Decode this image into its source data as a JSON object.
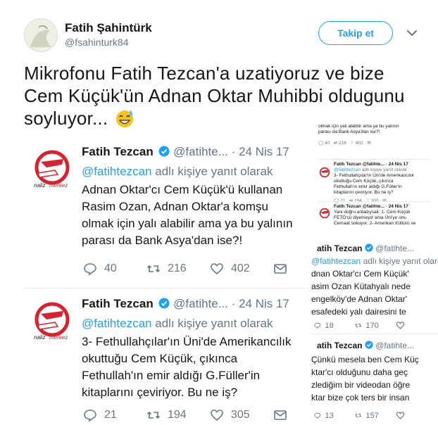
{
  "author": {
    "name": "Fatih Şahintürk",
    "handle": "@fsahinturk84",
    "follow_label": "Takip et"
  },
  "tweet": {
    "text": "Mikrofonu Fatih Tezcan'a uzatiyoruz ve bize Cem Küçük'ün Adnan Oktar Muhibbi oldugunu soyluyor...",
    "emoji": "sweat-smile-emoji"
  },
  "quoted_tweets": [
    {
      "name": "Fatih Tezcan",
      "handle": "@fatihte...",
      "sep": "·",
      "date": "24 Nis 17",
      "reply_link": "@fatihtezcan",
      "reply_text": "adlı kişiye yanıt olarak",
      "lines": [
        "Adnan Oktar'cı Cem Küçük'ü kullanan",
        "Rasim Ozan, Adnan Oktar'a komşu",
        "olmak için yalı alabilir ama ya bu yalının",
        "parası da Bank Asya'dan ise?!"
      ],
      "replies": "40",
      "retweets": "216",
      "likes": "402"
    },
    {
      "name": "Fatih Tezcan",
      "handle": "@fatihte...",
      "sep": "·",
      "date": "24 Nis 17",
      "reply_link": "@fatihtezcan",
      "reply_text": "adlı kişiye yanıt olarak",
      "lines": [
        "3- Fethullahçılar'ın Üni'de Amerikancılık",
        "okuttuğu Cem Küçük, çıkınca",
        "Fethullah'ın emir aldığı G.Füller'in",
        "kitaplarını çeviriyor. Bu ne iş?"
      ],
      "replies": "21",
      "retweets": "194",
      "likes": "305"
    }
  ],
  "right_column": {
    "small1": {
      "lines": [
        "olmak için yalı alabilir ama ya bu yalının",
        "parası da Bank Asya'dan ise?!"
      ],
      "replies": "40",
      "retweets": "216",
      "likes": "402"
    },
    "small2": {
      "header": "Fatih Tezcan @fatihte... · 24 Nis 17",
      "reply_link": "@fatihtezcan",
      "reply_text": "adlı kişiye yanıt olarak",
      "lines": [
        "3- Fethullahçılar'ın Üni'de Amerikancılık",
        "okuttuğu Cem Küçük, çıkınca",
        "Fethullah'ın emir aldığı G.Füller'in",
        "kitaplarını çeviriyor. Bu ne iş?"
      ],
      "replies": "21",
      "retweets": "194",
      "likes": "305"
    },
    "small3": {
      "header": "Fatih Tezcan @fatihte... · 24 Nis 17",
      "lines": [
        "Yani doğru anladıysak: 1- Cem Küçük",
        "FETÖ'cü diyemeyiz ama Üni'ye onu",
        "Cemaat sokuyor. 2- Amerikan Kültürü ve"
      ]
    },
    "mid1": {
      "name": "atih Tezcan",
      "handle": "@fatihte...",
      "reply_link": "@fatihtezcan",
      "reply_text": "adlı kişiye yanıt olarak",
      "lines": [
        "dnan Oktar'cı Cem Küçük'",
        "asim Ozan Kütahyalı nede",
        "engelköy'de Adnan Oktar'",
        "esafedeki yalı dairesini te"
      ],
      "replies": "18",
      "retweets": "170"
    },
    "mid2": {
      "name": "atih Tezcan",
      "handle": "@fatihte...",
      "lines": [
        "Çünkü mesela ben Cem Küç",
        "ktar'cı olduğunu daha geç",
        "zlediğim bir videodan öğre",
        "ktar bize çok ters bir insan"
      ],
      "replies": "13",
      "retweets": "157"
    }
  },
  "colors": {
    "accent": "#1da1f2",
    "muted": "#657786",
    "logo_red": "#d7232f"
  }
}
